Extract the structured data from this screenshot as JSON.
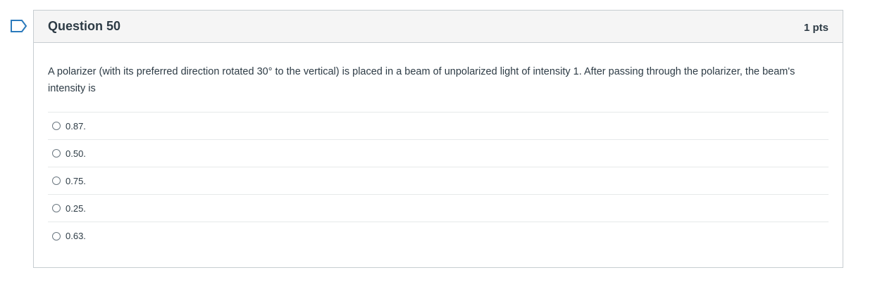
{
  "flag": {
    "icon": "bookmark-flag-icon",
    "color": "#2b7abc"
  },
  "question": {
    "title": "Question 50",
    "points": "1 pts",
    "text": "A polarizer (with its preferred direction rotated 30° to the vertical) is placed in a beam of unpolarized light of intensity 1. After passing through the polarizer, the beam's intensity is",
    "answers": [
      {
        "label": "0.87."
      },
      {
        "label": "0.50."
      },
      {
        "label": "0.75."
      },
      {
        "label": "0.25."
      },
      {
        "label": "0.63."
      }
    ]
  }
}
